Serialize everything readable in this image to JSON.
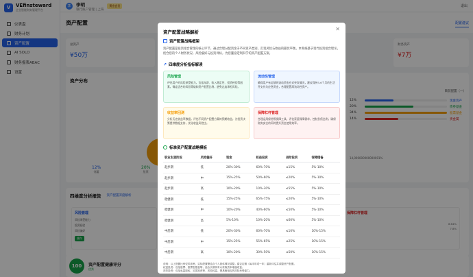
{
  "brand": {
    "name": "VEfinsteward",
    "subtitle": "企业智能财务管理平台"
  },
  "sidebar": {
    "items": [
      {
        "label": "仪表盘",
        "active": false
      },
      {
        "label": "财务计划",
        "active": false
      },
      {
        "label": "资产配置",
        "active": true
      },
      {
        "label": "AI SOLO",
        "active": false
      },
      {
        "label": "财务报表ABAC",
        "active": false
      },
      {
        "label": "设置",
        "active": false
      }
    ]
  },
  "user": {
    "initial": "李",
    "name": "李明",
    "subtitle": "银行账户管理 | 上海",
    "badge": "黄金会员"
  },
  "topbar": {
    "right": "退出"
  },
  "page": {
    "title": "资产配置",
    "tab": "配置建议"
  },
  "stats": [
    {
      "label": "总资产",
      "value": "¥50万"
    },
    {
      "label": "财务资产",
      "value": "¥7万"
    }
  ],
  "distribution": {
    "title": "资产分布",
    "legend": "目前配置（一）",
    "pcts": [
      {
        "value": "12%",
        "label": "储蓄"
      },
      {
        "value": "20%",
        "label": "股票"
      }
    ],
    "bars": [
      {
        "pct": "12%",
        "name": "现金资产",
        "fill": 0.12,
        "color": "#2563eb"
      },
      {
        "pct": "20%",
        "name": "债券基金",
        "fill": 0.2,
        "color": "#16a34a"
      },
      {
        "pct": "34%",
        "name": "股票基金",
        "fill": 0.34,
        "color": "#f59e0b"
      },
      {
        "pct": "14%",
        "name": "贵金属",
        "fill": 0.14,
        "color": "#dc2626"
      }
    ],
    "axis_value": "14,000000000000001%"
  },
  "report": {
    "title": "四维度分析报告",
    "link": "资产配置深度解析",
    "risk": "风险管理",
    "risk_rows": [
      "风险承受能力",
      "投资经验",
      "风险偏好"
    ],
    "leverage": "保障杠杆管理",
    "leverage_vals": [
      "8.64%",
      "7.8%"
    ],
    "btn": "操作"
  },
  "score": {
    "value": "100",
    "title": "资产配置健康评分",
    "sub": "优秀"
  },
  "modal": {
    "title": "资产配置战略解析",
    "sec1": "资产配置战略框架",
    "intro": "资产配置是投资组合管理的核心环节，通过合理分配资金于不同资产类别，实现风险与收益的最优平衡。本系统基于现代投资组合理论，结合您的个人财务状况、风险偏好与投资目标，为您量身定制科学的资产配置方案。",
    "sec2": "四维度分析指标解读",
    "boxes": [
      {
        "title": "风险管理",
        "text": "评估用户的风险承受能力，包括年龄、收入稳定性、投资经验等因素，确定适合的风险等级和资产配置比例，避免过度承担风险。",
        "bg": "#ecfdf5",
        "color": "#16a34a"
      },
      {
        "title": "流动性管理",
        "text": "确保用户有足够的流动资金应对突发情况，建议保持3-6个月的生活开支作为应急资金，合理配置高流动性资产。",
        "bg": "#eff6ff",
        "color": "#2563eb"
      },
      {
        "title": "收益率回测",
        "text": "分析历史收益率数据，评估不同资产配置方案的预期收益，为投资决策提供数据支持，优化收益风险比。",
        "bg": "#fffbeb",
        "color": "#f59e0b"
      },
      {
        "title": "保障杠杆管理",
        "text": "合理运用保险等保障工具，评估家庭保障需求，控制负债比例，确保财务安全的同时提升资金使用效率。",
        "bg": "#fef2f2",
        "color": "#dc2626"
      }
    ],
    "sec3": "标准资产配置战略模板",
    "table": {
      "headers": [
        "职业生涯阶段",
        "风险偏好",
        "现金",
        "权益投资",
        "进阶投资",
        "保障储备"
      ],
      "rows": [
        [
          "起步期",
          "低",
          "20%-30%",
          "60%-70%",
          "≤15%",
          "5%-10%"
        ],
        [
          "起步期",
          "中",
          "15%-25%",
          "50%-60%",
          "≤20%",
          "5%-10%"
        ],
        [
          "起步期",
          "高",
          "10%-20%",
          "10%-30%",
          "≤55%",
          "5%-10%"
        ],
        [
          "稳健期",
          "低",
          "15%-25%",
          "65%-75%",
          "≤20%",
          "5%-10%"
        ],
        [
          "稳健期",
          "中",
          "10%-20%",
          "40%-60%",
          "≤50%",
          "5%-10%"
        ],
        [
          "稳健期",
          "高",
          "5%-10%",
          "10%-20%",
          "≤60%",
          "5%-10%"
        ],
        [
          "中后期",
          "低",
          "20%-30%",
          "60%-70%",
          "≤10%",
          "10%-15%"
        ],
        [
          "中后期",
          "中",
          "15%-25%",
          "55%-65%",
          "≤25%",
          "10%-15%"
        ],
        [
          "中后期",
          "高",
          "10%-20%",
          "30%-50%",
          "≤50%",
          "10%-15%"
        ]
      ]
    },
    "notes": [
      "说明：以上配置比例仅供参考，实际配置需结合个人具体情况调整，建议定期（每半年或一年）重新评估并调整资产配置。",
      "权益投资：包括股票、股票型基金等，适合长期持有以获取资本增值收益。",
      "进阶投资：包括私募股权、另类投资等，风险较高，需具备相应的风险承受能力。",
      "保障储备：包括各类保险、应急资金等，为家庭财务安全提供基础保障。"
    ]
  }
}
